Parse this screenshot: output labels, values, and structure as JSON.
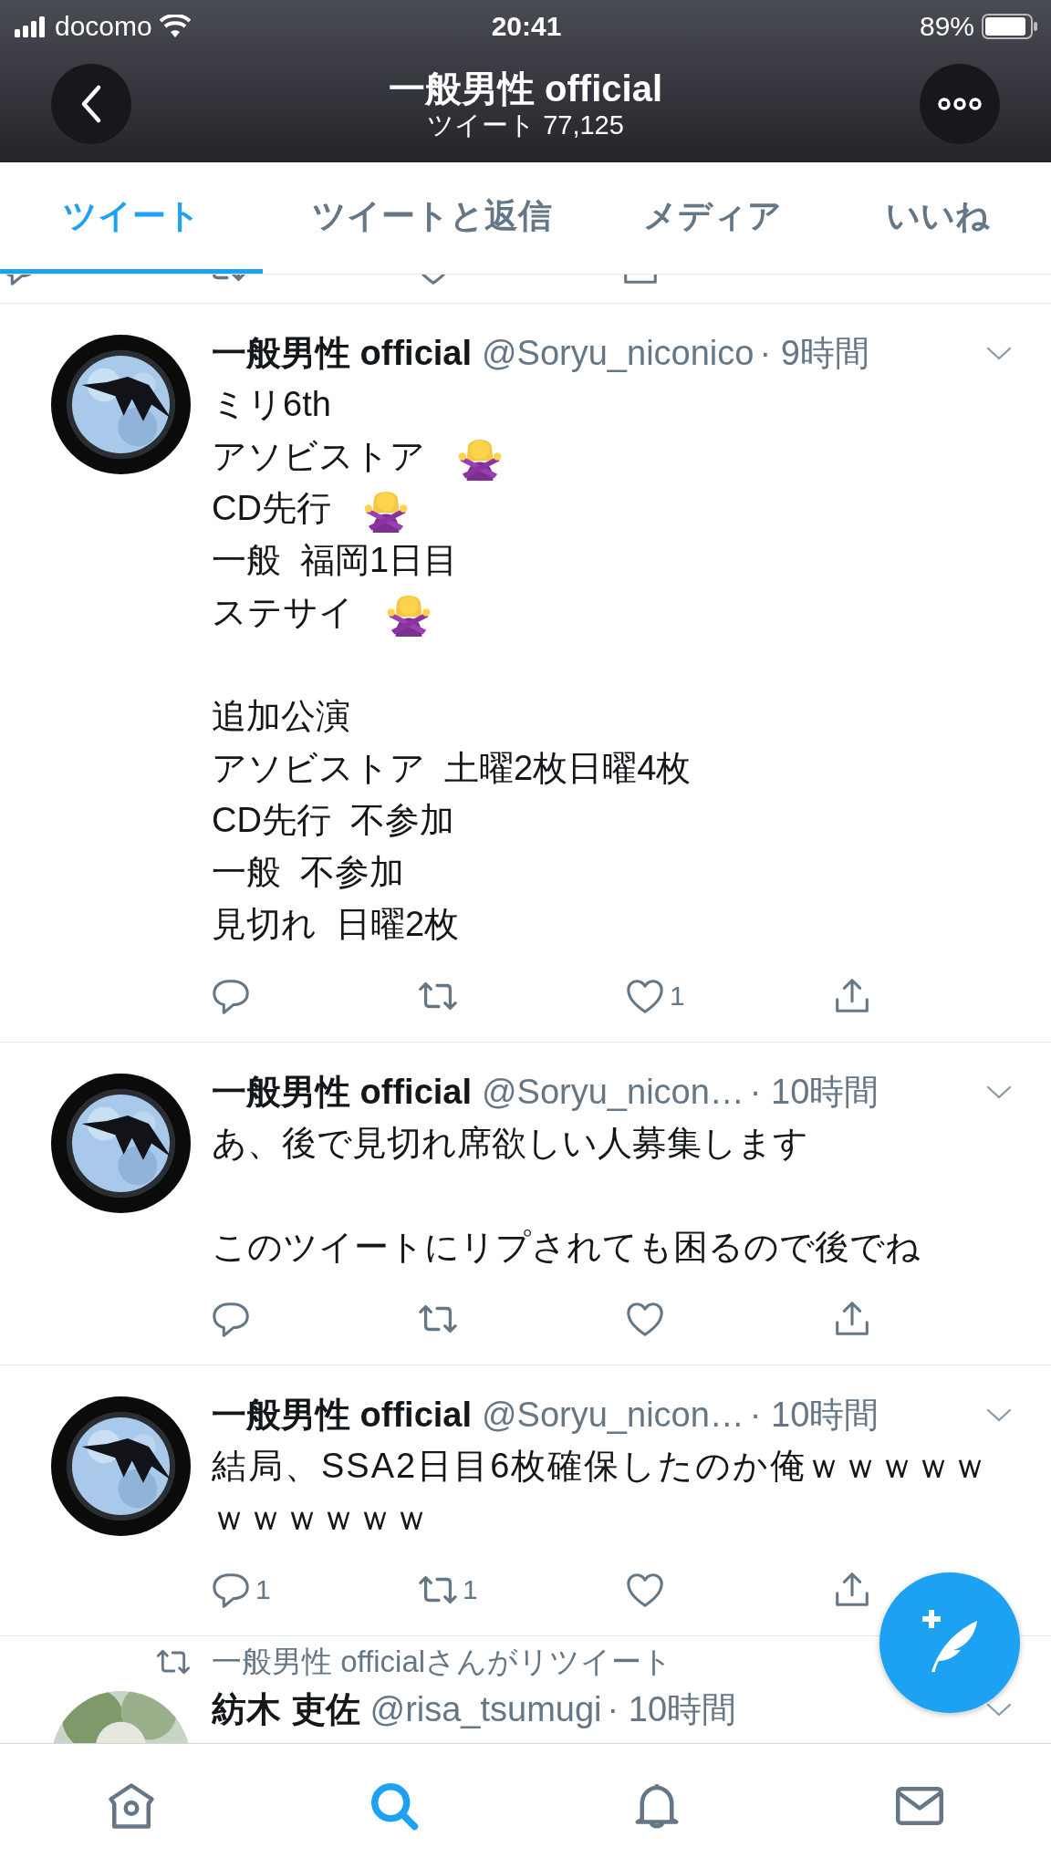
{
  "status_bar": {
    "carrier": "docomo",
    "time": "20:41",
    "battery": "89%"
  },
  "header": {
    "title": "一般男性 official",
    "subtitle": "ツイート 77,125"
  },
  "tabs": [
    {
      "label": "ツイート",
      "selected": true
    },
    {
      "label": "ツイートと返信",
      "selected": false
    },
    {
      "label": "メディア",
      "selected": false
    },
    {
      "label": "いいね",
      "selected": false
    }
  ],
  "tweets": [
    {
      "name": "一般男性 official",
      "handle": "@Soryu_niconico",
      "time": "· 9時間",
      "paragraphs": [
        [
          {
            "text": "ミリ6th",
            "emoji": false
          },
          {
            "text": "アソビストア",
            "emoji": true
          },
          {
            "text": "CD先行",
            "emoji": true
          },
          {
            "text": "一般  福岡1日目",
            "emoji": false
          },
          {
            "text": "ステサイ",
            "emoji": true
          }
        ],
        [
          {
            "text": "追加公演",
            "emoji": false
          },
          {
            "text": "アソビストア  土曜2枚日曜4枚",
            "emoji": false
          },
          {
            "text": "CD先行  不参加",
            "emoji": false
          },
          {
            "text": "一般  不参加",
            "emoji": false
          },
          {
            "text": "見切れ  日曜2枚",
            "emoji": false
          }
        ]
      ],
      "likes": "1"
    },
    {
      "name": "一般男性 official",
      "handle": "@Soryu_nicon…",
      "time": "· 10時間",
      "paragraphs": [
        [
          {
            "text": "あ、後で見切れ席欲しい人募集します",
            "emoji": false
          }
        ],
        [
          {
            "text": "このツイートにリプされても困るので後でね",
            "emoji": false
          }
        ]
      ]
    },
    {
      "name": "一般男性 official",
      "handle": "@Soryu_nicon…",
      "time": "· 10時間",
      "paragraphs": [
        [
          {
            "text": "結局、SSA2日目6枚確保したのか俺ｗｗｗｗｗｗｗｗｗｗｗ",
            "emoji": false
          }
        ]
      ],
      "replies": "1",
      "retweets": "1"
    }
  ],
  "retweeted_tweet": {
    "retweet_label": "一般男性 officialさんがリツイート",
    "name": "紡木 吏佐",
    "handle": "@risa_tsumugi",
    "time": "· 10時間"
  },
  "bottom_nav": [
    {
      "kind": "home",
      "selected": false
    },
    {
      "kind": "search",
      "selected": true
    },
    {
      "kind": "notifications",
      "selected": false
    },
    {
      "kind": "messages",
      "selected": false
    }
  ]
}
